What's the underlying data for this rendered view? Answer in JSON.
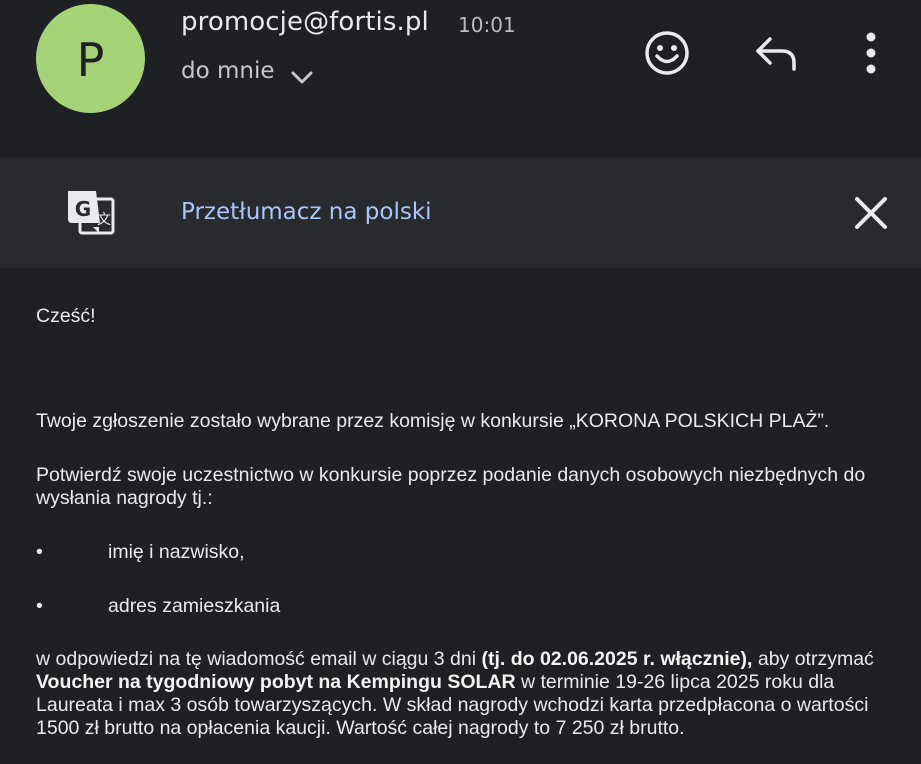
{
  "header": {
    "avatar_letter": "P",
    "sender": "promocje@fortis.pl",
    "time": "10:01",
    "recipient": "do mnie",
    "icons": [
      "emoji-icon",
      "reply-icon",
      "more-vert-icon",
      "chevron-down-icon"
    ]
  },
  "translate": {
    "label": "Przetłumacz na polski",
    "icons": [
      "translate-icon",
      "close-icon"
    ]
  },
  "body": {
    "greeting": "Cześć!",
    "p1": "Twoje zgłoszenie zostało wybrane przez komisję w konkursie „KORONA POLSKICH PLAŻ”.",
    "p2": "Potwierdź swoje uczestnictwo w konkursie poprzez podanie danych osobowych niezbędnych do wysłania nagrody tj.:",
    "bullet_symbol": "•",
    "bullets": [
      "imię i nazwisko,",
      "adres zamieszkania"
    ],
    "p3": {
      "part1": "w odpowiedzi na tę wiadomość email w ciągu 3 dni ",
      "bold1": "(tj. do 02.06.2025 r. włącznie),",
      "part2": " aby otrzymać ",
      "bold2": "Voucher na tygodniowy pobyt na Kempingu SOLAR",
      "part3": " w terminie 19-26 lipca 2025 roku dla Laureata i max 3 osób towarzyszących. W skład nagrody wchodzi karta przedpłacona o wartości 1500 zł brutto na opłacenia kaucji. Wartość całej nagrody to 7 250 zł brutto."
    }
  },
  "colors": {
    "background": "#1f2023",
    "translate_bar": "#292a2d",
    "avatar": "#a6d278",
    "link": "#a8c7fa"
  }
}
